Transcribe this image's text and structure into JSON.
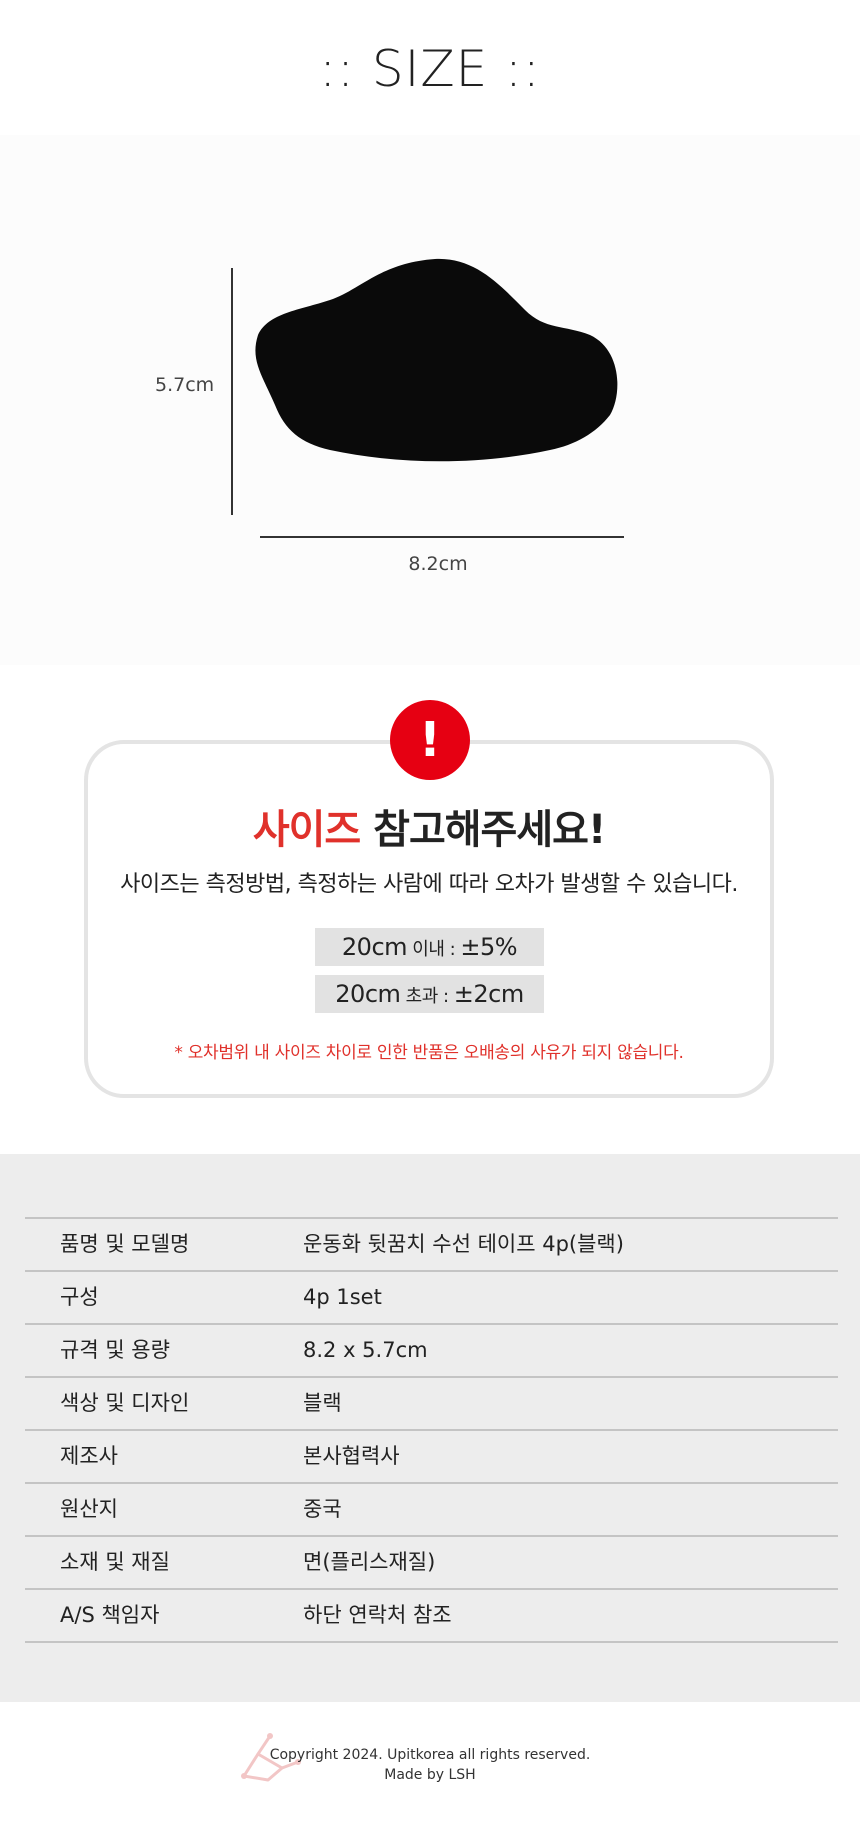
{
  "header": {
    "title": ":: SIZE ::"
  },
  "diagram": {
    "height_label": "5.7cm",
    "width_label": "8.2cm"
  },
  "notice": {
    "icon_label": "!",
    "headline_red": "사이즈",
    "headline_black": " 참고해주세요!",
    "subtitle": "사이즈는 측정방법, 측정하는 사람에 따라 오차가 발생할 수 있습니다.",
    "tolerance": [
      {
        "size": "20cm",
        "cond": " 이내 : ",
        "value": "±5%"
      },
      {
        "size": "20cm",
        "cond": " 초과 : ",
        "value": "±2cm"
      }
    ],
    "warning": "* 오차범위 내 사이즈 차이로 인한 반품은 오배송의 사유가 되지 않습니다."
  },
  "spec": {
    "rows": [
      {
        "key": "품명 및 모델명",
        "value": "운동화 뒷꿈치 수선 테이프 4p(블랙)"
      },
      {
        "key": "구성",
        "value": "4p 1set"
      },
      {
        "key": "규격 및 용량",
        "value": "8.2 x 5.7cm"
      },
      {
        "key": "색상 및 디자인",
        "value": "블랙"
      },
      {
        "key": "제조사",
        "value": "본사협력사"
      },
      {
        "key": "원산지",
        "value": "중국"
      },
      {
        "key": "소재 및 재질",
        "value": "면(플리스재질)"
      },
      {
        "key": "A/S 책임자",
        "value": "하단 연락처 참조"
      }
    ]
  },
  "footer": {
    "copyright": "Copyright 2024. Upitkorea all rights reserved.",
    "made_by": "Made by LSH"
  }
}
